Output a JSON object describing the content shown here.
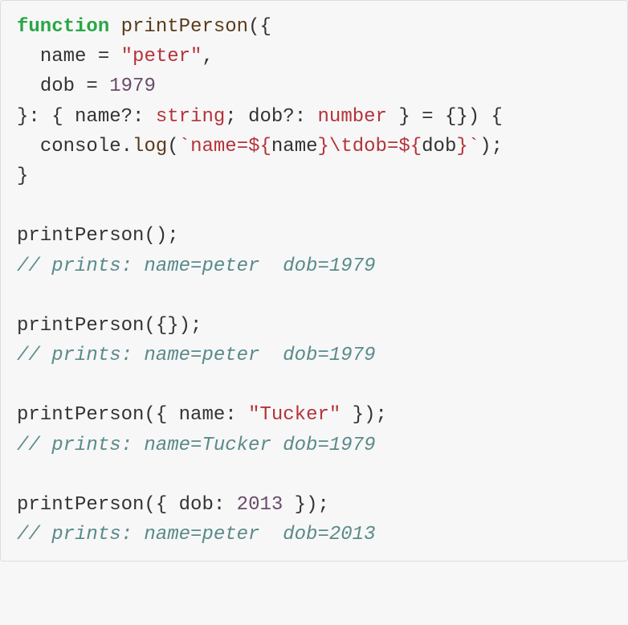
{
  "code": {
    "line1": {
      "kw": "function",
      "fn": "printPerson",
      "open": "({"
    },
    "line2": {
      "indent": "  ",
      "name_key": "name",
      "eq": " = ",
      "name_val": "\"peter\"",
      "comma": ","
    },
    "line3": {
      "indent": "  ",
      "dob_key": "dob",
      "eq": " = ",
      "dob_val": "1979"
    },
    "line4": {
      "close_destruct": "}: { ",
      "name_prop": "name",
      "opt1": "?: ",
      "string_type": "string",
      "sep": "; ",
      "dob_prop": "dob",
      "opt2": "?: ",
      "number_type": "number",
      "rest": " } = {}) {"
    },
    "line5": {
      "indent": "  ",
      "console": "console",
      "dot": ".",
      "log": "log",
      "open": "(",
      "tick1": "`",
      "t_name": "name=",
      "dollar1": "${",
      "expr_name": "name",
      "close1": "}",
      "tab": "\\t",
      "t_dob": "dob=",
      "dollar2": "${",
      "expr_dob": "dob",
      "close2": "}",
      "tick2": "`",
      "end": ");"
    },
    "line6": "}",
    "blank": "",
    "call1": "printPerson();",
    "comment1": "// prints: name=peter  dob=1979",
    "call2": "printPerson({});",
    "comment2": "// prints: name=peter  dob=1979",
    "call3_a": "printPerson({ ",
    "call3_key": "name",
    "call3_colon": ": ",
    "call3_val": "\"Tucker\"",
    "call3_b": " });",
    "comment3": "// prints: name=Tucker dob=1979",
    "call4_a": "printPerson({ ",
    "call4_key": "dob",
    "call4_colon": ": ",
    "call4_val": "2013",
    "call4_b": " });",
    "comment4": "// prints: name=peter  dob=2013"
  }
}
